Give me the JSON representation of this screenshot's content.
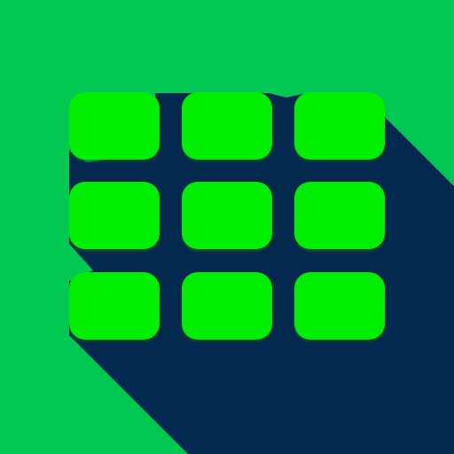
{
  "icon": {
    "name": "grid-app-icon",
    "background_color": "#00C853",
    "shadow_color": "#032A4E",
    "tile_color": "#00EE00",
    "tile_rows": 3,
    "tile_columns": 3
  }
}
